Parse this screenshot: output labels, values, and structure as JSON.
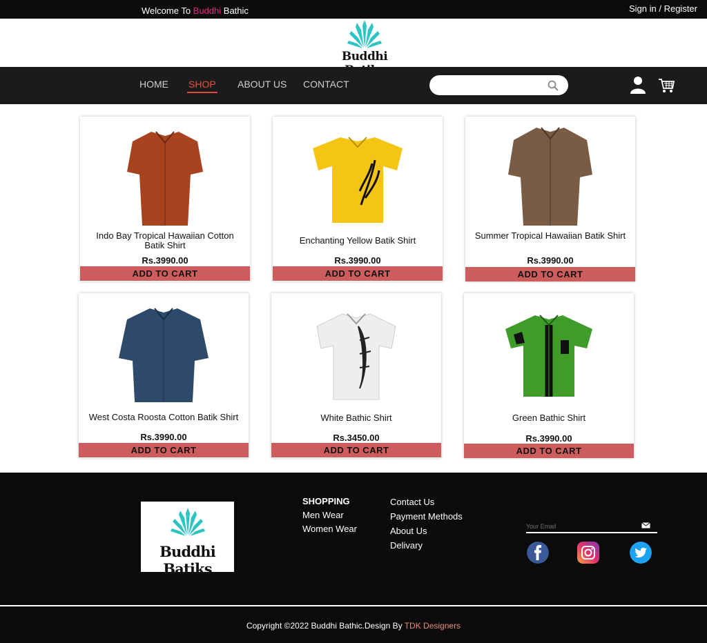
{
  "topbar": {
    "welcome_prefix": "Welcome To ",
    "welcome_brand": "Buddhi",
    "welcome_suffix": " Bathic",
    "auth": "Sign in / Register"
  },
  "logo": {
    "word": "Buddhi Batiks"
  },
  "nav": {
    "items": [
      {
        "label": "HOME"
      },
      {
        "label": "SHOP"
      },
      {
        "label": "ABOUT US"
      },
      {
        "label": "CONTACT"
      }
    ],
    "active": "SHOP",
    "search_placeholder": ""
  },
  "products": [
    {
      "name": "Indo Bay Tropical Hawaiian Cotton Batik Shirt",
      "price": "Rs.3990.00",
      "button": "ADD TO CART",
      "color": "#a8431f"
    },
    {
      "name": "Enchanting Yellow Batik Shirt",
      "price": "Rs.3990.00",
      "button": "ADD TO CART",
      "color": "#f5c516"
    },
    {
      "name": "Summer Tropical Hawaiian Batik Shirt",
      "price": "Rs.3990.00",
      "button": "ADD TO CART",
      "color": "#7a5c45"
    },
    {
      "name": "West Costa Roosta Cotton Batik Shirt",
      "price": "Rs.3990.00",
      "button": "ADD TO CART",
      "color": "#2e4a6b"
    },
    {
      "name": "White Bathic Shirt",
      "price": "Rs.3450.00",
      "button": "ADD TO CART",
      "color": "#eeeeee"
    },
    {
      "name": "Green Bathic Shirt",
      "price": "Rs.3990.00",
      "button": "ADD TO CART",
      "color": "#3f9c2a"
    }
  ],
  "footer": {
    "logo_word": "Buddhi Batiks",
    "shopping_head": "SHOPPING",
    "shopping_links": [
      "Men Wear",
      "Women Wear"
    ],
    "info_links": [
      "Contact Us",
      "Payment Methods",
      "About Us",
      "Delivary"
    ],
    "email_placeholder": "Your Email",
    "copyright_prefix": "Copyright ",
    "copyright_mid": "2022 Buddhi Bathic.Design By ",
    "copyright_dev": "TDK Designers"
  },
  "colors": {
    "accent_pink": "#e0287c",
    "button_red": "#cd5c5c",
    "nav_underline": "#e54b3a",
    "logo_teal": "#2ec4c4"
  },
  "icons": [
    "search-icon",
    "user-icon",
    "cart-icon",
    "email-icon",
    "facebook-icon",
    "instagram-icon",
    "twitter-icon",
    "copyright-icon"
  ]
}
